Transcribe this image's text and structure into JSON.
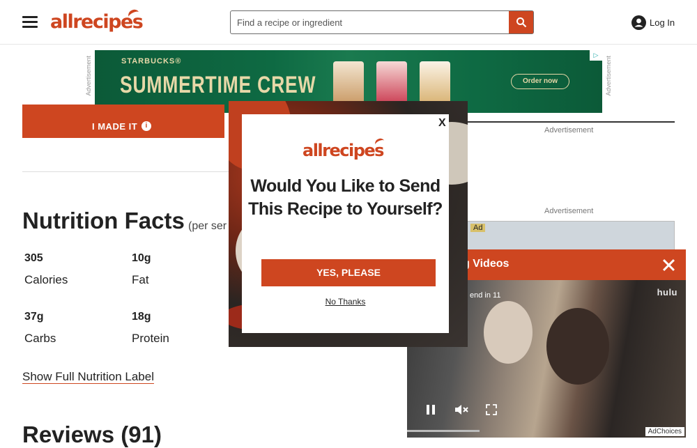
{
  "header": {
    "logo": "allrecipes",
    "search_placeholder": "Find a recipe or ingredient",
    "login_label": "Log In"
  },
  "top_ad": {
    "side_label": "Advertisement",
    "brand": "STARBUCKS®",
    "headline": "SUMMERTIME CREW",
    "cta": "Order now"
  },
  "main": {
    "made_it_label": "I MADE IT",
    "nutrition_title": "Nutrition Facts",
    "nutrition_subtitle": "(per ser",
    "facts": [
      {
        "value": "305",
        "label": "Calories"
      },
      {
        "value": "10g",
        "label": "Fat"
      },
      {
        "value": "37g",
        "label": "Carbs"
      },
      {
        "value": "18g",
        "label": "Protein"
      }
    ],
    "show_full_label": "Show Full Nutrition Label",
    "reviews_title": "Reviews (91)"
  },
  "rail": {
    "advertisement_label": "Advertisement",
    "ad_tag": "Ad"
  },
  "video": {
    "title": "ding Videos",
    "end_text": "end in 11",
    "network": "hulu",
    "adchoices": "AdChoices"
  },
  "modal": {
    "close_label": "X",
    "logo": "allrecipes",
    "heading": "Would You Like to Send This Recipe to Yourself?",
    "yes_label": "YES, PLEASE",
    "no_label": "No Thanks"
  }
}
